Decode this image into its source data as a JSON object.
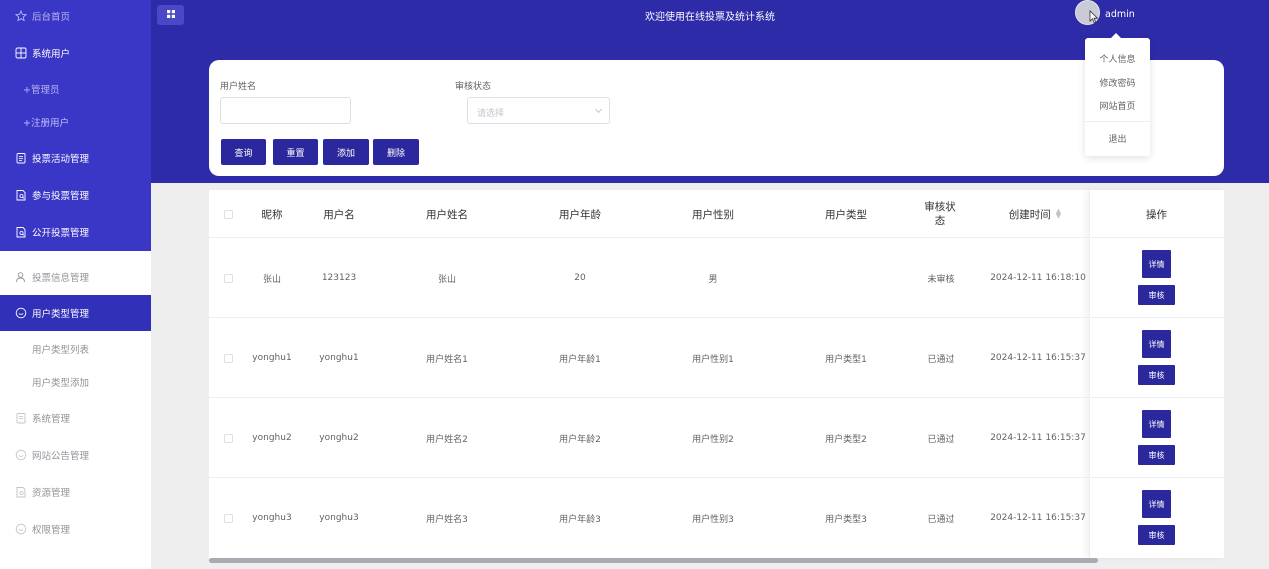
{
  "header": {
    "title": "欢迎使用在线投票及统计系统",
    "username": "admin"
  },
  "user_menu": {
    "items": [
      "个人信息",
      "修改密码",
      "网站首页"
    ],
    "logout": "退出"
  },
  "sidebar": {
    "items": [
      {
        "label": "后台首页",
        "icon": "star-icon"
      },
      {
        "label": "系统用户",
        "icon": "grid-icon"
      },
      {
        "label": "+管理员"
      },
      {
        "label": "+注册用户"
      },
      {
        "label": "投票活动管理",
        "icon": "clipboard-icon"
      },
      {
        "label": "参与投票管理",
        "icon": "file-search-icon"
      },
      {
        "label": "公开投票管理",
        "icon": "file-search-icon"
      },
      {
        "label": "投票信息管理",
        "icon": "user-icon"
      },
      {
        "label": "用户类型管理",
        "icon": "chat-icon"
      },
      {
        "label": "用户类型列表"
      },
      {
        "label": "用户类型添加"
      },
      {
        "label": "系统管理",
        "icon": "clipboard-icon"
      },
      {
        "label": "网站公告管理",
        "icon": "chat-icon"
      },
      {
        "label": "资源管理",
        "icon": "file-search-icon"
      },
      {
        "label": "权限管理",
        "icon": "chat-icon"
      }
    ]
  },
  "search": {
    "name_label": "用户姓名",
    "name_value": "",
    "status_label": "审核状态",
    "status_placeholder": "请选择",
    "buttons": {
      "query": "查询",
      "reset": "重置",
      "add": "添加",
      "delete": "删除"
    }
  },
  "table": {
    "columns": [
      "昵称",
      "用户名",
      "用户姓名",
      "用户年龄",
      "用户性别",
      "用户类型",
      "审核状态",
      "创建时间",
      "操作"
    ],
    "rows": [
      {
        "nickname": "张山",
        "username": "123123",
        "name": "张山",
        "age": "20",
        "gender": "男",
        "type": "",
        "status": "未审核",
        "created": "2024-12-11 16:18:10"
      },
      {
        "nickname": "yonghu1",
        "username": "yonghu1",
        "name": "用户姓名1",
        "age": "用户年龄1",
        "gender": "用户性别1",
        "type": "用户类型1",
        "status": "已通过",
        "created": "2024-12-11 16:15:37"
      },
      {
        "nickname": "yonghu2",
        "username": "yonghu2",
        "name": "用户姓名2",
        "age": "用户年龄2",
        "gender": "用户性别2",
        "type": "用户类型2",
        "status": "已通过",
        "created": "2024-12-11 16:15:37"
      },
      {
        "nickname": "yonghu3",
        "username": "yonghu3",
        "name": "用户姓名3",
        "age": "用户年龄3",
        "gender": "用户性别3",
        "type": "用户类型3",
        "status": "已通过",
        "created": "2024-12-11 16:15:37"
      }
    ],
    "action_detail": "详情",
    "action_review": "审核"
  },
  "colors": {
    "primary": "#2e2ba8",
    "sidebar_purple": "#3b37c6",
    "button": "#2b289e"
  }
}
